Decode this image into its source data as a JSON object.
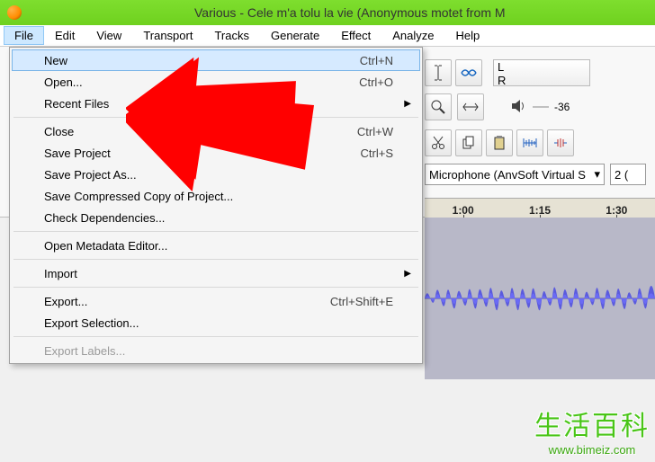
{
  "window": {
    "title": "Various - Cele m'a tolu la vie (Anonymous motet from M"
  },
  "menubar": [
    "File",
    "Edit",
    "View",
    "Transport",
    "Tracks",
    "Generate",
    "Effect",
    "Analyze",
    "Help"
  ],
  "file_menu": {
    "items": [
      {
        "label": "New",
        "shortcut": "Ctrl+N",
        "highlight": true
      },
      {
        "label": "Open...",
        "shortcut": "Ctrl+O"
      },
      {
        "label": "Recent Files",
        "submenu": true
      },
      {
        "sep": true
      },
      {
        "label": "Close",
        "shortcut": "Ctrl+W"
      },
      {
        "label": "Save Project",
        "shortcut": "Ctrl+S"
      },
      {
        "label": "Save Project As..."
      },
      {
        "label": "Save Compressed Copy of Project..."
      },
      {
        "label": "Check Dependencies..."
      },
      {
        "sep": true
      },
      {
        "label": "Open Metadata Editor..."
      },
      {
        "sep": true
      },
      {
        "label": "Import",
        "submenu": true
      },
      {
        "sep": true
      },
      {
        "label": "Export...",
        "shortcut": "Ctrl+Shift+E"
      },
      {
        "label": "Export Selection..."
      },
      {
        "sep": true
      },
      {
        "label": "Export Labels...",
        "disabled": true
      }
    ]
  },
  "toolbar": {
    "meter": {
      "L": "L",
      "R": "R"
    },
    "volume_readout": "-36",
    "input_device": "Microphone (AnvSoft Virtual S",
    "channels": "2 ("
  },
  "timeline": [
    "1:00",
    "1:15",
    "1:30"
  ],
  "watermark": {
    "cn": "生活百科",
    "url": "www.bimeiz.com"
  }
}
